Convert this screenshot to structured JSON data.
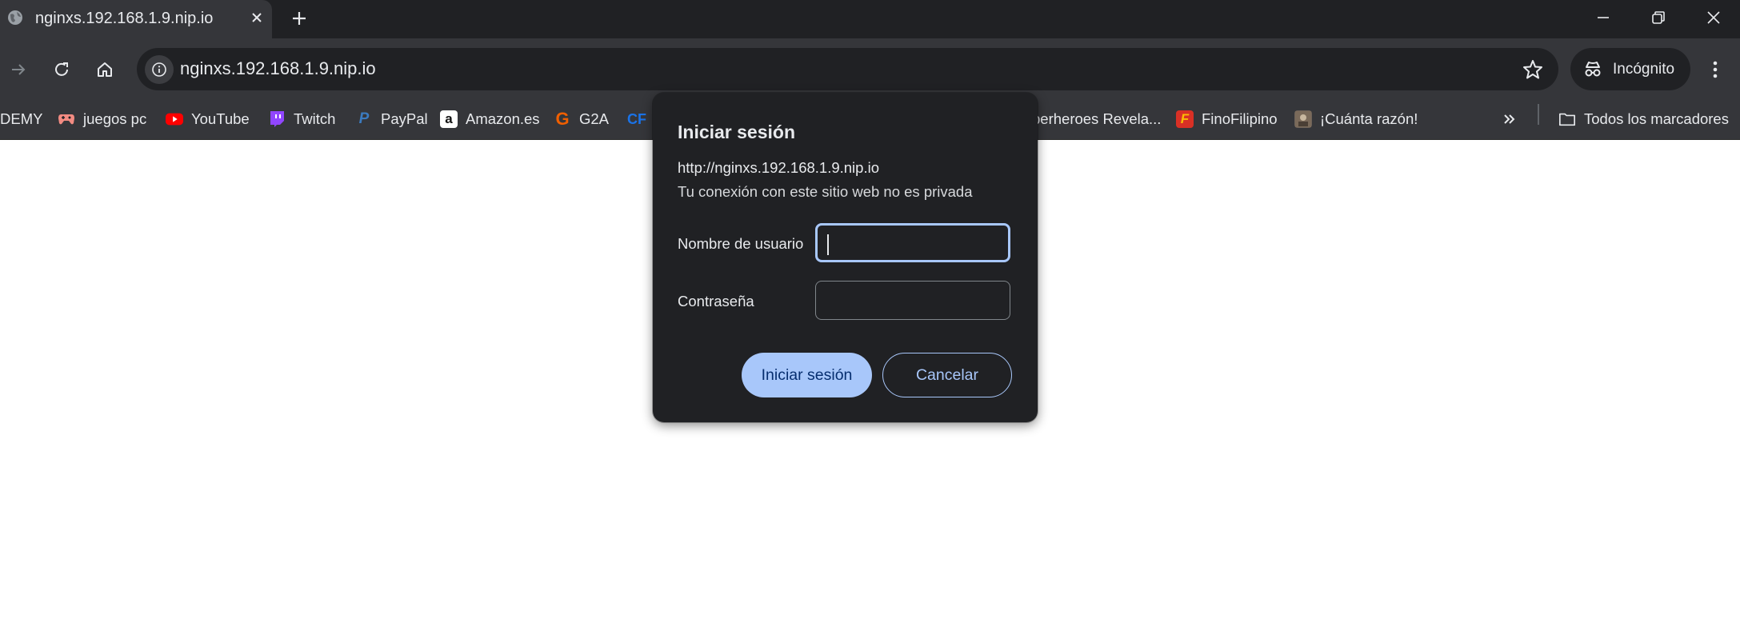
{
  "tab": {
    "title": "nginxs.192.168.1.9.nip.io"
  },
  "omnibox": {
    "url": "nginxs.192.168.1.9.nip.io"
  },
  "incognito_label": "Incógnito",
  "bookmarks": {
    "items": [
      {
        "label": "DEMY",
        "icon": "none"
      },
      {
        "label": "juegos pc",
        "icon": "gamepad-icon"
      },
      {
        "label": "YouTube",
        "icon": "youtube-icon"
      },
      {
        "label": "Twitch",
        "icon": "twitch-icon"
      },
      {
        "label": "PayPal",
        "icon": "paypal-icon"
      },
      {
        "label": "Amazon.es",
        "icon": "amazon-icon"
      },
      {
        "label": "G2A",
        "icon": "g2a-icon"
      },
      {
        "label": "CF",
        "icon": "cf-icon"
      },
      {
        "label": "perheroes Revela...",
        "icon": "none"
      },
      {
        "label": "FinoFilipino",
        "icon": "finofilipino-icon"
      },
      {
        "label": "¡Cuánta razón!",
        "icon": "cuanta-razon-icon"
      }
    ],
    "all_bookmarks": "Todos los marcadores"
  },
  "dialog": {
    "title": "Iniciar sesión",
    "origin": "http://nginxs.192.168.1.9.nip.io",
    "privacy_note": "Tu conexión con este sitio web no es privada",
    "username_label": "Nombre de usuario",
    "username_value": "",
    "password_label": "Contraseña",
    "password_value": "",
    "sign_in_button": "Iniciar sesión",
    "cancel_button": "Cancelar"
  },
  "colors": {
    "frame": "#202124",
    "toolbar": "#35363a",
    "accent": "#a8c7fa",
    "accent_text": "#062e6f"
  }
}
